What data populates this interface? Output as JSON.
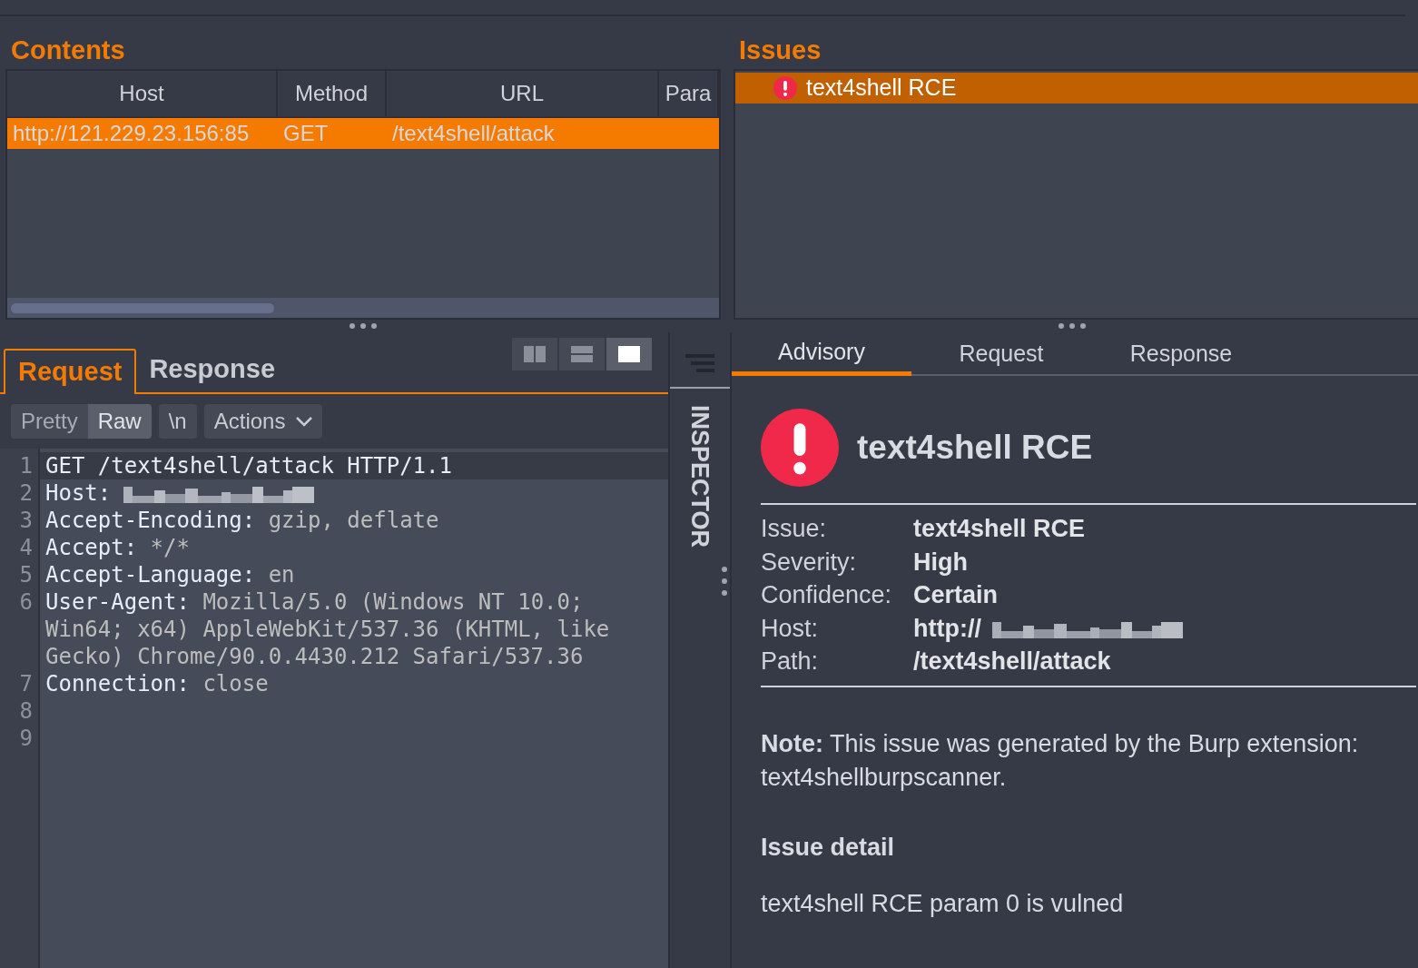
{
  "contents": {
    "title": "Contents",
    "columns": [
      "Host",
      "Method",
      "URL",
      "Para"
    ],
    "rows": [
      {
        "cells": [
          "http://121.229.23.156:85",
          "GET",
          "/text4shell/attack"
        ],
        "selected": true
      }
    ]
  },
  "issues": {
    "title": "Issues",
    "items": [
      {
        "label": "text4shell RCE",
        "selected": true
      }
    ]
  },
  "request_editor": {
    "tabs": [
      {
        "label": "Request",
        "selected": true
      },
      {
        "label": "Response",
        "selected": false
      }
    ],
    "view_modes": [
      {
        "kind": "columns",
        "selected": false
      },
      {
        "kind": "rows",
        "selected": false
      },
      {
        "kind": "single",
        "selected": true
      }
    ],
    "formats": [
      {
        "label": "Pretty",
        "selected": false
      },
      {
        "label": "Raw",
        "selected": true
      }
    ],
    "newline_button": "\\n",
    "actions": "Actions",
    "lines": [
      {
        "number": "1",
        "key": "GET /text4shell/attack HTTP/1.1",
        "highlighted": true,
        "redacted": false
      },
      {
        "number": "2",
        "key": "Host:",
        "highlighted": false,
        "redacted": true
      },
      {
        "number": "3",
        "key": "Accept-Encoding:",
        "value": "gzip, deflate",
        "highlighted": false,
        "redacted": false
      },
      {
        "number": "4",
        "key": "Accept:",
        "value": "*/*",
        "highlighted": false,
        "redacted": false
      },
      {
        "number": "5",
        "key": "Accept-Language:",
        "value": "en",
        "highlighted": false,
        "redacted": false
      },
      {
        "number": "6",
        "key": "User-Agent:",
        "value": "Mozilla/5.0 (Windows NT 10.0; Win64; x64) AppleWebKit/537.36 (KHTML, like Gecko) Chrome/90.0.4430.212 Safari/537.36",
        "highlighted": false,
        "redacted": false
      },
      {
        "number": "7",
        "key": "Connection:",
        "value": "close",
        "highlighted": false,
        "redacted": false
      },
      {
        "number": "8",
        "highlighted": false,
        "redacted": false
      },
      {
        "number": "9",
        "highlighted": false,
        "redacted": false
      }
    ]
  },
  "inspector": {
    "label": "INSPECTOR"
  },
  "advisory": {
    "tabs": [
      {
        "label": "Advisory",
        "selected": true
      },
      {
        "label": "Request",
        "selected": false
      },
      {
        "label": "Response",
        "selected": false
      }
    ],
    "title": "text4shell RCE",
    "details": [
      {
        "label": "Issue:",
        "value": "text4shell RCE",
        "redacted": false
      },
      {
        "label": "Severity:",
        "value": "High",
        "redacted": false
      },
      {
        "label": "Confidence:",
        "value": "Certain",
        "redacted": false
      },
      {
        "label": "Host:",
        "value": "http://",
        "redacted": true
      },
      {
        "label": "Path:",
        "value": "/text4shell/attack",
        "redacted": false
      }
    ],
    "note": "**Note:** This issue was generated by the Burp extension: text4shellburpscanner.",
    "detail_heading": "Issue detail",
    "detail_text": "text4shell RCE param 0 is vulned"
  }
}
